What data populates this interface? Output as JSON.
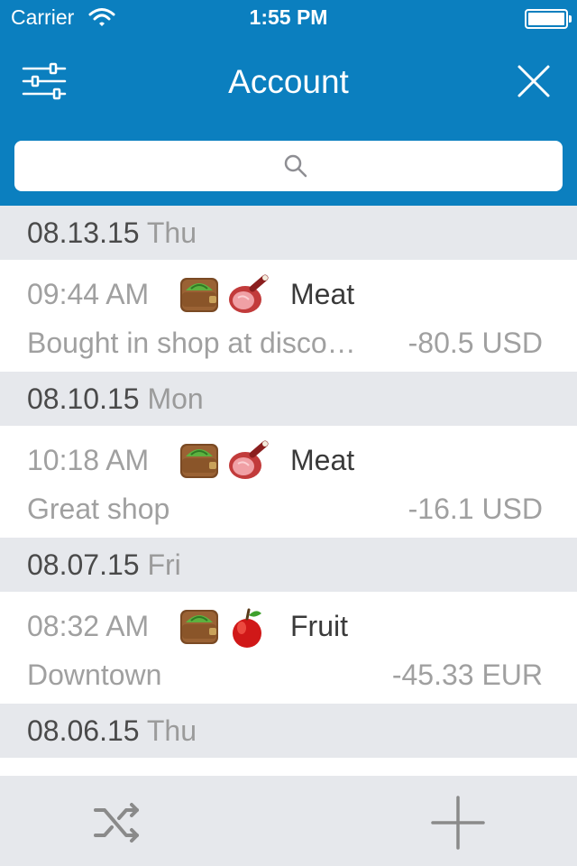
{
  "status_bar": {
    "carrier": "Carrier",
    "time": "1:55 PM"
  },
  "nav": {
    "title": "Account"
  },
  "colors": {
    "header": "#0b7fbf",
    "section": "#e6e8ec"
  },
  "groups": [
    {
      "date": "08.13.15",
      "weekday": "Thu",
      "entries": [
        {
          "time": "09:44 AM",
          "icons": [
            "wallet-icon",
            "meat-icon"
          ],
          "category": "Meat",
          "note": "Bought in shop at disco…",
          "amount": "-80.5 USD"
        }
      ]
    },
    {
      "date": "08.10.15",
      "weekday": "Mon",
      "entries": [
        {
          "time": "10:18 AM",
          "icons": [
            "wallet-icon",
            "meat-icon"
          ],
          "category": "Meat",
          "note": "Great shop",
          "amount": "-16.1 USD"
        }
      ]
    },
    {
      "date": "08.07.15",
      "weekday": "Fri",
      "entries": [
        {
          "time": "08:32 AM",
          "icons": [
            "wallet-icon",
            "apple-icon"
          ],
          "category": "Fruit",
          "note": "Downtown",
          "amount": "-45.33 EUR"
        }
      ]
    },
    {
      "date": "08.06.15",
      "weekday": "Thu",
      "entries": [
        {
          "time": "",
          "icons": [
            "wallet-icon",
            "apple-icon"
          ],
          "category": "",
          "note": "",
          "amount": ""
        }
      ]
    }
  ],
  "tabbar": {
    "left_icon": "shuffle-icon",
    "right_icon": "plus-icon"
  }
}
